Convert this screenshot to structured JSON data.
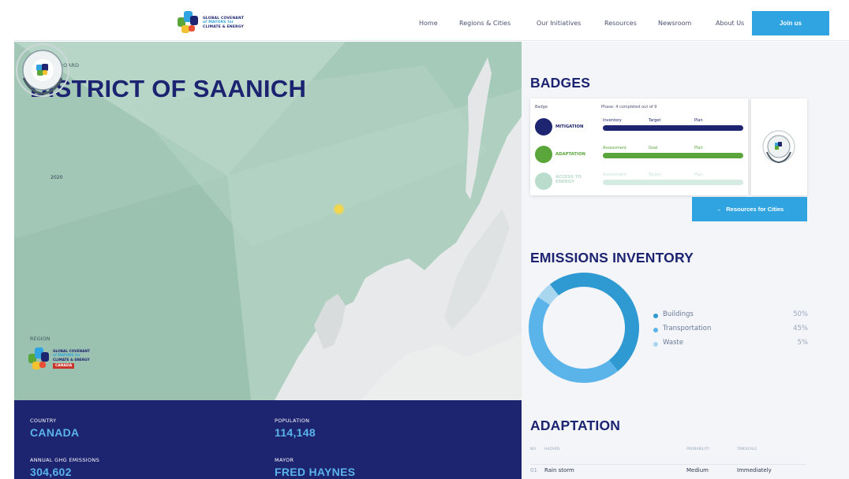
{
  "header": {
    "logo_text": [
      "GLOBAL COVENANT",
      "of MAYORS for",
      "CLIMATE & ENERGY"
    ],
    "nav": [
      "Home",
      "Regions & Cities",
      "Our Initiatives",
      "Resources",
      "Newsroom",
      "About Us"
    ],
    "join_label": "Join us"
  },
  "hero": {
    "dashboard_label": "CITY DASHBOARD",
    "city": "DISTRICT OF SAANICH",
    "badge_year": "2020",
    "region_label": "REGION",
    "region_logo_text": [
      "GLOBAL COVENANT",
      "of MAYORS for",
      "CLIMATE & ENERGY"
    ],
    "region_tag": "CANADA"
  },
  "info": {
    "country_label": "COUNTRY",
    "country": "CANADA",
    "population_label": "POPULATION",
    "population": "114,148",
    "emissions_label": "ANNUAL GHG EMISSIONS",
    "emissions": "304,602",
    "mayor_label": "MAYOR",
    "mayor": "FRED HAYNES"
  },
  "badges": {
    "title": "BADGES",
    "col_badge": "Badge",
    "col_phase": "Phase: 4 completed out of 9",
    "rows": [
      {
        "name": "MITIGATION",
        "steps": [
          "Inventory",
          "Target",
          "Plan"
        ],
        "color": "#1d2470",
        "faded": false
      },
      {
        "name": "ADAPTATION",
        "steps": [
          "Assessment",
          "Goal",
          "Plan"
        ],
        "color": "#5aa63b",
        "faded": false
      },
      {
        "name": "ACCESS TO ENERGY",
        "steps": [
          "Assessment",
          "Target",
          "Plan"
        ],
        "color": "#b9dccc",
        "faded": true
      }
    ],
    "resources_label": "Resources for Cities",
    "resources_icon": "arrow-right-icon"
  },
  "emissions": {
    "title": "EMISSIONS INVENTORY",
    "legend": [
      {
        "name": "Buildings",
        "value": "50%",
        "color": "#2f99d1"
      },
      {
        "name": "Transportation",
        "value": "45%",
        "color": "#5ab4ea"
      },
      {
        "name": "Waste",
        "value": "5%",
        "color": "#a8d6ef"
      }
    ]
  },
  "adaptation": {
    "title": "ADAPTATION",
    "columns": [
      "NO.",
      "HAZARD",
      "PROBABILITY",
      "TIMESCALE"
    ],
    "rows": [
      {
        "no": "01",
        "hazard": "Rain storm",
        "probability": "Medium",
        "timescale": "Immediately"
      }
    ]
  }
}
